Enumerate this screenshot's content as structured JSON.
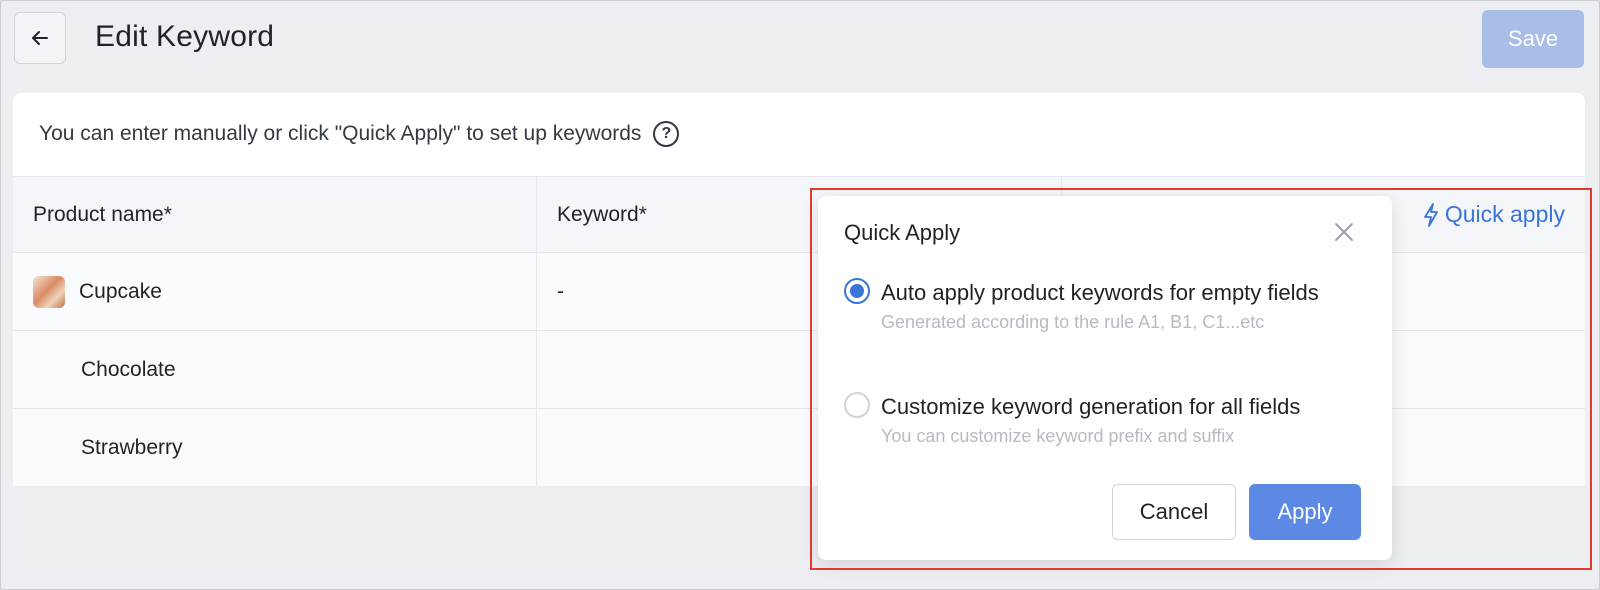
{
  "header": {
    "title": "Edit Keyword",
    "save_label": "Save"
  },
  "hint": {
    "text": "You can enter manually or click \"Quick Apply\" to set up keywords"
  },
  "table": {
    "columns": [
      "Product name*",
      "Keyword*"
    ],
    "quick_apply_label": "Quick apply",
    "rows": [
      {
        "name": "Cupcake",
        "keyword": "-"
      },
      {
        "name": "Chocolate",
        "keyword": ""
      },
      {
        "name": "Strawberry",
        "keyword": ""
      }
    ]
  },
  "popover": {
    "title": "Quick Apply",
    "options": [
      {
        "label": "Auto apply product keywords for empty fields",
        "description": "Generated according to the rule A1, B1, C1...etc",
        "checked": true
      },
      {
        "label": "Customize keyword generation for all fields",
        "description": "You can customize keyword prefix and suffix",
        "checked": false
      }
    ],
    "cancel_label": "Cancel",
    "apply_label": "Apply"
  },
  "colors": {
    "accent": "#3a74d9",
    "apply_button": "#5b89e3",
    "save_disabled": "#a9bde9",
    "annotation": "#e03a2e"
  },
  "icons": [
    "back-arrow-icon",
    "help-circle-icon",
    "lightning-icon",
    "close-icon"
  ]
}
